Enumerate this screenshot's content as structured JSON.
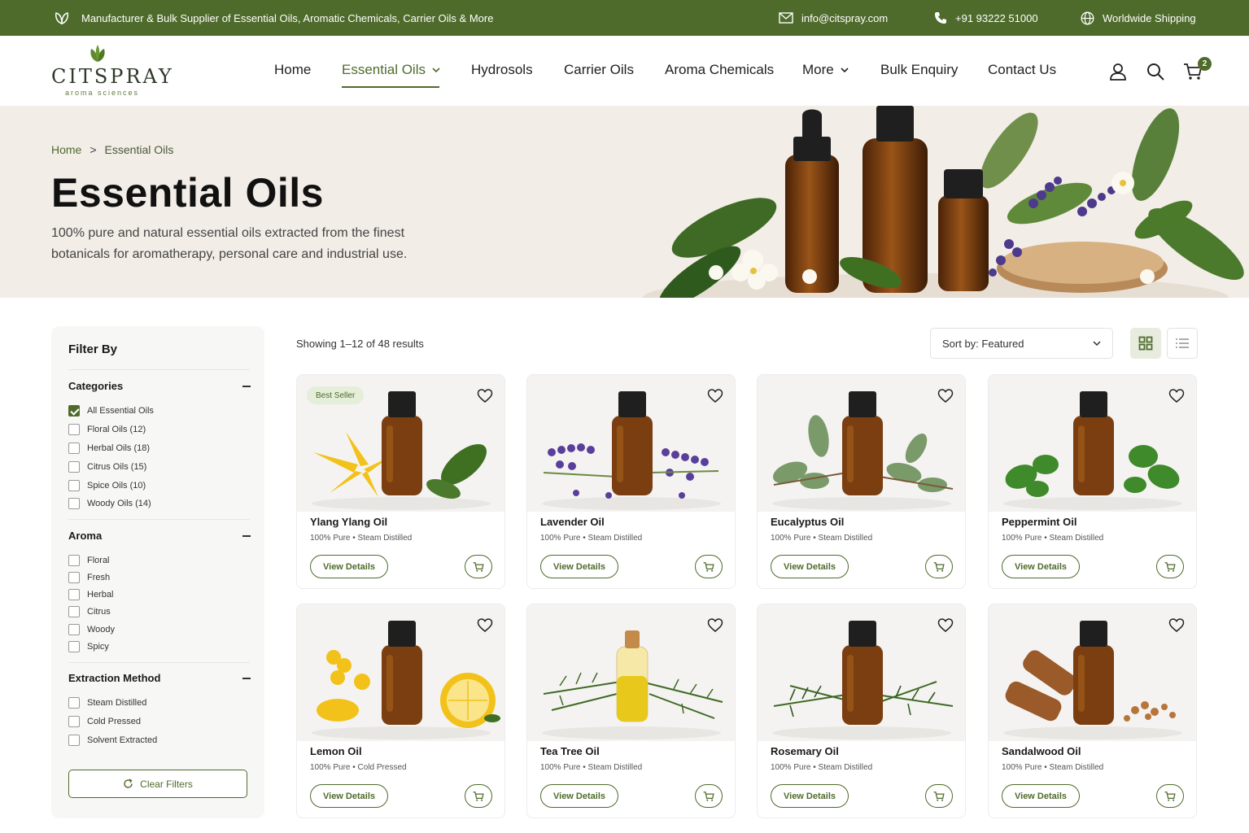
{
  "topbar": {
    "tagline": "Manufacturer & Bulk Supplier of Essential Oils, Aromatic Chemicals, Carrier Oils & More",
    "email": "info@citspray.com",
    "phone": "+91 93222 51000",
    "shipping": "Worldwide Shipping"
  },
  "logo": {
    "brand": "CITSPRAY",
    "tagline": "aroma sciences"
  },
  "nav": {
    "items": [
      "Home",
      "Essential Oils",
      "Hydrosols",
      "Carrier Oils",
      "Aroma Chemicals",
      "More",
      "Bulk Enquiry",
      "Contact Us"
    ],
    "cart_count": "2"
  },
  "hero": {
    "breadcrumb_home": "Home",
    "breadcrumb_sep": ">",
    "breadcrumb_current": "Essential Oils",
    "title": "Essential Oils",
    "description": "100% pure and natural essential oils extracted from the finest botanicals for aromatherapy, personal care and industrial use."
  },
  "filters": {
    "title": "Filter By",
    "categories_title": "Categories",
    "categories": [
      "All Essential Oils",
      "Floral Oils (12)",
      "Herbal Oils (18)",
      "Citrus Oils (15)",
      "Spice Oils (10)",
      "Woody Oils (14)"
    ],
    "aroma_title": "Aroma",
    "aroma": [
      "Floral",
      "Fresh",
      "Herbal",
      "Citrus",
      "Woody",
      "Spicy"
    ],
    "extraction_title": "Extraction Method",
    "extraction": [
      "Steam Distilled",
      "Cold Pressed",
      "Solvent Extracted"
    ],
    "clear": "Clear Filters"
  },
  "listing": {
    "results": "Showing 1–12 of 48 results",
    "sort": "Sort by: Featured"
  },
  "products": [
    {
      "name": "Ylang Ylang Oil",
      "sub": "100% Pure • Steam Distilled",
      "badge": "Best Seller",
      "button": "View Details"
    },
    {
      "name": "Lavender Oil",
      "sub": "100% Pure • Steam Distilled",
      "button": "View Details"
    },
    {
      "name": "Eucalyptus Oil",
      "sub": "100% Pure • Steam Distilled",
      "button": "View Details"
    },
    {
      "name": "Peppermint Oil",
      "sub": "100% Pure • Steam Distilled",
      "button": "View Details"
    },
    {
      "name": "Lemon Oil",
      "sub": "100% Pure • Cold Pressed",
      "button": "View Details"
    },
    {
      "name": "Tea Tree Oil",
      "sub": "100% Pure • Steam Distilled",
      "button": "View Details"
    },
    {
      "name": "Rosemary Oil",
      "sub": "100% Pure • Steam Distilled",
      "button": "View Details"
    },
    {
      "name": "Sandalwood Oil",
      "sub": "100% Pure • Steam Distilled",
      "button": "View Details"
    }
  ],
  "colors": {
    "brand_green": "#4f6b2c",
    "amber_bottle": "#7a3e10",
    "hero_bg": "#f2ede7"
  }
}
